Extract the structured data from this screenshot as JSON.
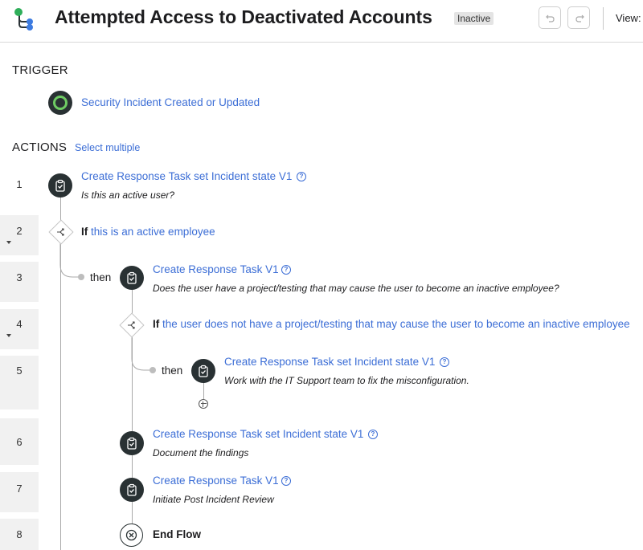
{
  "header": {
    "title": "Attempted Access to Deactivated Accounts",
    "status": "Inactive",
    "view_label": "View:"
  },
  "trigger": {
    "section_title": "TRIGGER",
    "label": "Security Incident Created or Updated"
  },
  "actions": {
    "section_title": "ACTIONS",
    "select_multiple": "Select multiple",
    "then_label": "then",
    "if_keyword": "If",
    "steps": [
      {
        "number": "1",
        "title": "Create Response Task set Incident state V1",
        "description": "Is this an active user?"
      },
      {
        "number": "2",
        "condition": "this is an active employee"
      },
      {
        "number": "3",
        "title": "Create Response Task V1",
        "description": "Does the user have a project/testing that may cause the user to become an inactive employee?"
      },
      {
        "number": "4",
        "condition": "the user does not have a project/testing that may cause the user to become an inactive employee"
      },
      {
        "number": "5",
        "title": "Create Response Task set Incident state V1",
        "description": "Work with the IT Support team to fix the misconfiguration."
      },
      {
        "number": "6",
        "title": "Create Response Task set Incident state V1",
        "description": "Document the findings"
      },
      {
        "number": "7",
        "title": "Create Response Task V1",
        "description": "Initiate Post Incident Review"
      },
      {
        "number": "8",
        "title": "End Flow"
      }
    ]
  },
  "icons": {
    "app_logo": "flow-logo-icon",
    "undo": "undo-icon",
    "redo": "redo-icon",
    "trigger": "trigger-ring-icon",
    "action": "task-clipboard-icon",
    "if": "branch-icon",
    "help": "help-circle-icon",
    "add": "add-step-icon",
    "end": "end-flow-icon"
  },
  "colors": {
    "link": "#3c6ed6",
    "icon_dark": "#293133",
    "trigger_ring": "#6ecb63",
    "logo_green": "#2fae5a",
    "logo_blue": "#3d7be0",
    "badge_bg": "#e4e4e4"
  }
}
